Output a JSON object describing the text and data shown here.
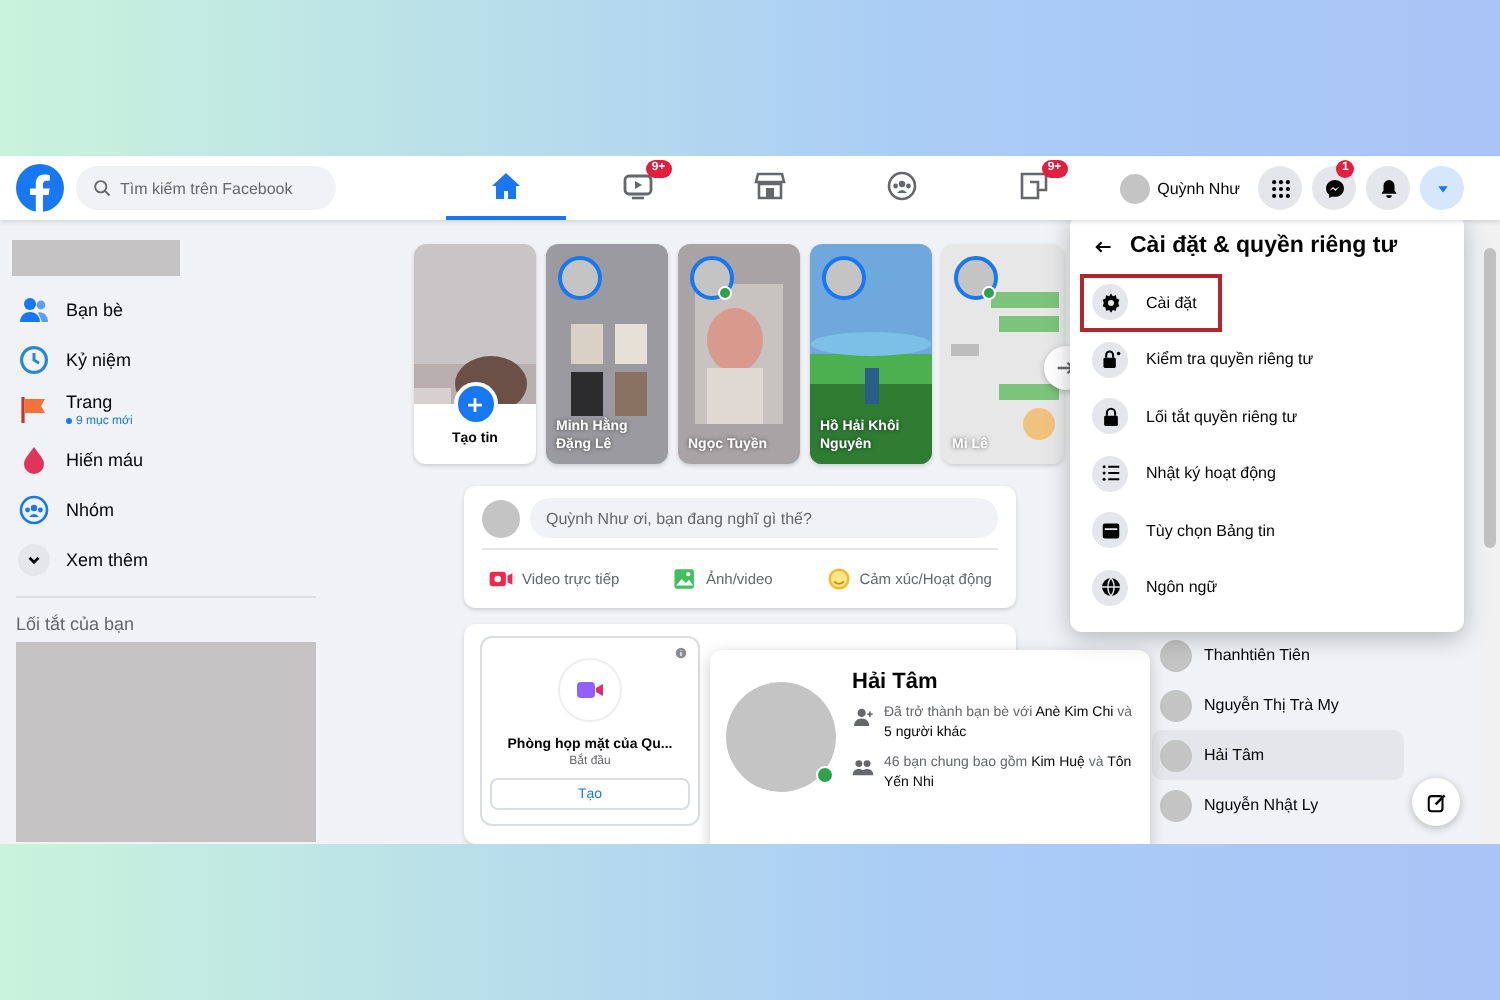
{
  "topbar": {
    "search": {
      "placeholder": "Tìm kiếm trên Facebook"
    },
    "nav": [
      {
        "selected": true
      },
      {
        "badge": "9+",
        "selected": false
      },
      {
        "selected": false
      },
      {
        "selected": false
      },
      {
        "badge": "9+",
        "selected": false
      }
    ],
    "profile_name": "Quỳnh Như",
    "actions": [
      {
        "selected": false
      },
      {
        "badge": "1",
        "selected": false
      },
      {
        "selected": false
      },
      {
        "selected": true
      }
    ]
  },
  "sidebar": {
    "items": [
      {
        "label": "Bạn bè"
      },
      {
        "label": "Kỷ niệm"
      },
      {
        "label": "Trang",
        "note": "9 mục mới"
      },
      {
        "label": "Hiến máu"
      },
      {
        "label": "Nhóm"
      },
      {
        "label": "Xem thêm"
      }
    ],
    "shortcuts_title": "Lối tắt của bạn"
  },
  "stories": [
    {
      "kind": "create",
      "label": "Tạo tin"
    },
    {
      "kind": "story",
      "name": "Minh Hằng Đặng Lê",
      "online": false
    },
    {
      "kind": "story",
      "name": "Ngọc Tuyền",
      "online": true
    },
    {
      "kind": "story",
      "name": "Hồ Hải Khôi Nguyên",
      "online": false
    },
    {
      "kind": "story",
      "name": "Mi Lê",
      "online": true
    }
  ],
  "composer": {
    "placeholder": "Quỳnh Như ơi, bạn đang nghĩ gì thế?",
    "actions": [
      "Video trực tiếp",
      "Ảnh/video",
      "Cảm xúc/Hoạt động"
    ]
  },
  "room_card": {
    "title": "Phòng họp mặt của Qu...",
    "subtitle": "Bắt đầu",
    "button": "Tạo"
  },
  "hovercard": {
    "name": "Hải Tâm",
    "online": true,
    "lines": [
      "Đã trở thành bạn bè với **Anè Kim Chi** và **5 người khác**",
      "46 bạn chung bao gồm **Kim Huệ** và **Tôn Yến Nhi**"
    ]
  },
  "menu": {
    "title": "Cài đặt & quyền riêng tư",
    "items": [
      {
        "label": "Cài đặt",
        "highlighted": true
      },
      {
        "label": "Kiểm tra quyền riêng tư",
        "highlighted": false
      },
      {
        "label": "Lối tắt quyền riêng tư",
        "highlighted": false
      },
      {
        "label": "Nhật ký hoạt động",
        "highlighted": false
      },
      {
        "label": "Tùy chọn Bảng tin",
        "highlighted": false
      },
      {
        "label": "Ngôn ngữ",
        "highlighted": false
      }
    ]
  },
  "contacts": [
    {
      "name": "Thanhtiên Tiên",
      "selected": false
    },
    {
      "name": "Nguyễn Thị Trà My",
      "selected": false
    },
    {
      "name": "Hải Tâm",
      "selected": true
    },
    {
      "name": "Nguyễn Nhật Ly",
      "selected": false
    }
  ]
}
